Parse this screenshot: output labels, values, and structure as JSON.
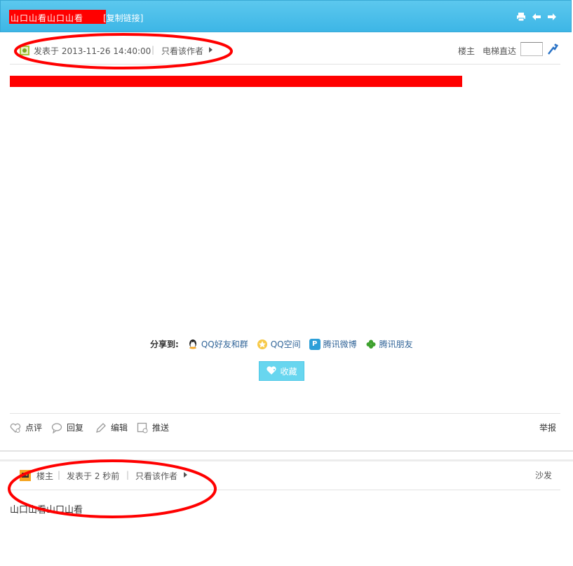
{
  "header": {
    "title": "山口山看山口山看",
    "copy_link": "[复制链接]",
    "tools": [
      "print-icon",
      "prev-icon",
      "next-icon"
    ]
  },
  "post1": {
    "post_time": "发表于 2013-11-26 14:40:00",
    "separator": "|",
    "author_only": "只看该作者",
    "floor": "楼主",
    "elevator_label": "电梯直达",
    "elevator_value": "",
    "content": "",
    "share_label": "分享到:",
    "share_items": [
      {
        "label": "QQ好友和群",
        "icon": "qq-icon",
        "color": "#2b7ad8"
      },
      {
        "label": "QQ空间",
        "icon": "qzone-icon",
        "color": "#f2b21c"
      },
      {
        "label": "腾讯微博",
        "icon": "tencent-weibo-icon",
        "color": "#2c9fd8"
      },
      {
        "label": "腾讯朋友",
        "icon": "tencent-friends-icon",
        "color": "#3ea12e"
      }
    ],
    "favorite_label": "收藏",
    "actions": [
      "点评",
      "回复",
      "编辑",
      "推送"
    ],
    "report": "举报"
  },
  "post2": {
    "floor": "楼主",
    "post_time": "发表于 2 秒前",
    "author_only": "只看该作者",
    "separator": "|",
    "floor_label": "沙发",
    "content": "山口山看山口山看"
  },
  "colors": {
    "header_bg": "#44bbe8",
    "annotation": "#ff0000",
    "redaction": "#ff0000",
    "favorite_button": "#68d6ef",
    "link": "#336699"
  }
}
